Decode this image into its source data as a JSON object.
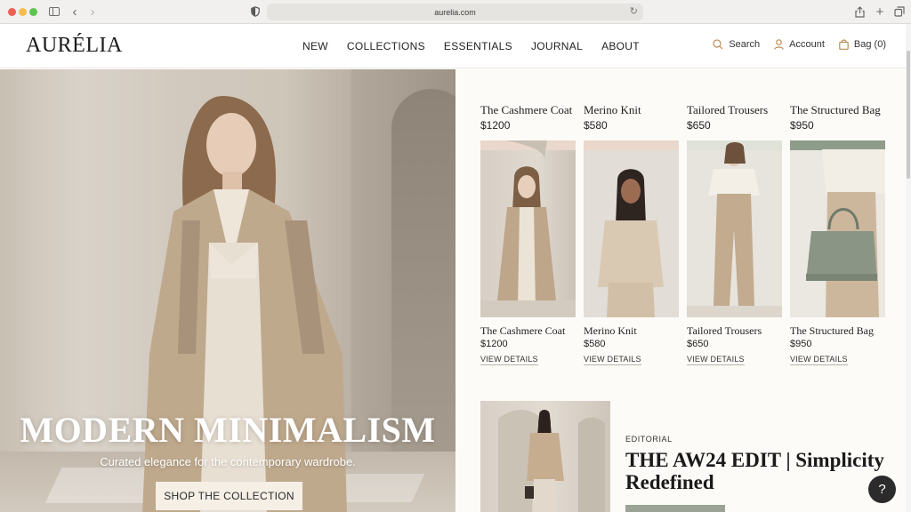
{
  "browser": {
    "url": "aurelia.com"
  },
  "header": {
    "logo": "AURÉLIA",
    "nav": [
      "NEW",
      "COLLECTIONS",
      "ESSENTIALS",
      "JOURNAL",
      "ABOUT"
    ],
    "search_label": "Search",
    "account_label": "Account",
    "bag_label": "Bag (0)"
  },
  "hero": {
    "title": "MODERN MINIMALISM",
    "subtitle": "Curated elegance for the contemporary wardrobe.",
    "cta": "SHOP THE COLLECTION"
  },
  "products_top": [
    {
      "name": "The Cashmere Coat",
      "price": "$1200"
    },
    {
      "name": "Merino Knit",
      "price": "$580"
    },
    {
      "name": "Tailored Trousers",
      "price": "$650"
    },
    {
      "name": "The Structured Bag",
      "price": "$950"
    }
  ],
  "products": [
    {
      "name": "The Cashmere Coat",
      "price": "$1200",
      "link": "VIEW DETAILS",
      "band_color": "#ead8cc"
    },
    {
      "name": "Merino Knit",
      "price": "$580",
      "link": "VIEW DETAILS",
      "band_color": "#ead8cc"
    },
    {
      "name": "Tailored Trousers",
      "price": "$650",
      "link": "VIEW DETAILS",
      "band_color": "#dfe2d8"
    },
    {
      "name": "The Structured Bag",
      "price": "$950",
      "link": "VIEW DETAILS",
      "band_color": "#8e9d8a"
    }
  ],
  "editorial": {
    "kicker": "EDITORIAL",
    "title": "THE AW24 EDIT | Simplicity Redefined"
  },
  "help_label": "?"
}
